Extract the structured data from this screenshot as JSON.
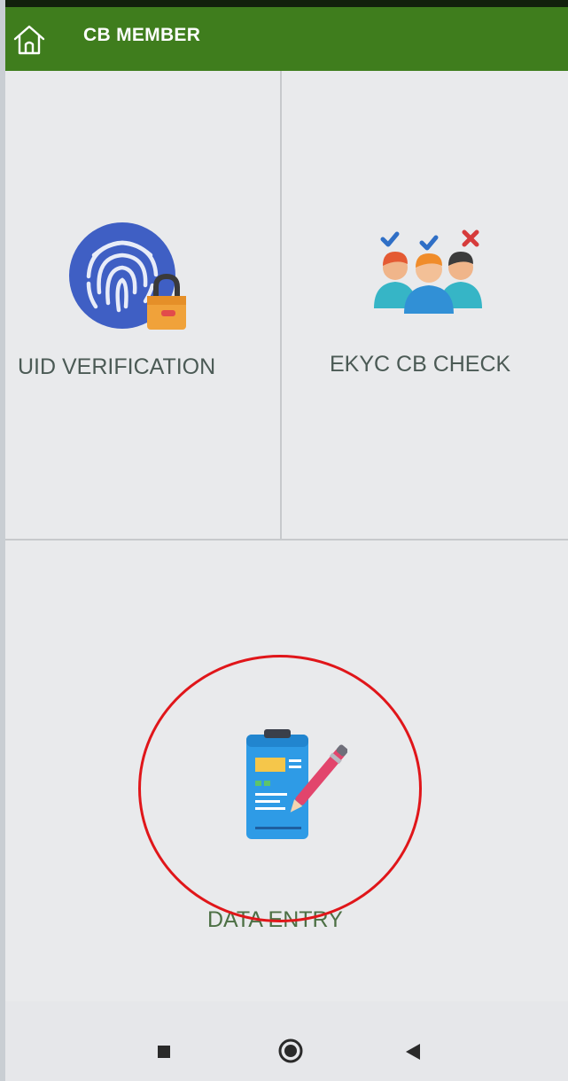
{
  "appbar": {
    "title": "CB MEMBER",
    "home_icon": "home-icon",
    "background_color": "#3f7d1d"
  },
  "tiles": [
    {
      "label": "UID VERIFICATION",
      "icon": "fingerprint-lock-icon"
    },
    {
      "label": "EKYC CB CHECK",
      "icon": "people-check-icon"
    },
    {
      "label": "DATA ENTRY",
      "icon": "data-entry-form-icon"
    }
  ],
  "annotation": {
    "type": "circle",
    "color": "#e0161a",
    "target": "DATA ENTRY"
  },
  "navbar": {
    "buttons": [
      "recents-icon",
      "home-circle-icon",
      "back-icon"
    ]
  }
}
